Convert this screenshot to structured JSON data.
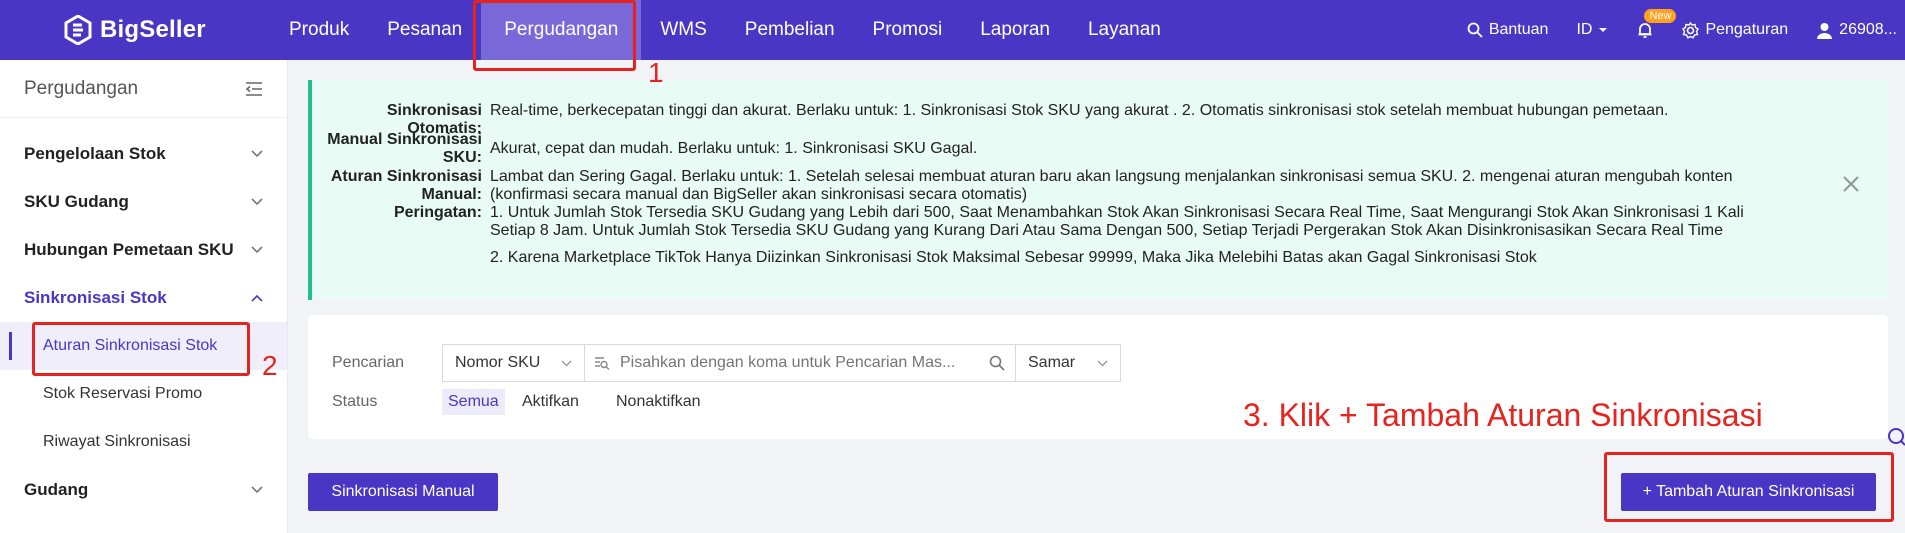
{
  "brand": {
    "name": "BigSeller"
  },
  "nav": {
    "items": [
      {
        "label": "Produk"
      },
      {
        "label": "Pesanan"
      },
      {
        "label": "Pergudangan",
        "active": true
      },
      {
        "label": "WMS"
      },
      {
        "label": "Pembelian"
      },
      {
        "label": "Promosi"
      },
      {
        "label": "Laporan"
      },
      {
        "label": "Layanan"
      }
    ],
    "help": "Bantuan",
    "language": "ID",
    "new_badge": "New",
    "settings": "Pengaturan",
    "user": "26908..."
  },
  "sidebar": {
    "title": "Pergudangan",
    "groups": [
      {
        "label": "Pengelolaan Stok"
      },
      {
        "label": "SKU Gudang"
      },
      {
        "label": "Hubungan Pemetaan SKU"
      },
      {
        "label": "Sinkronisasi Stok"
      }
    ],
    "sub_items": [
      {
        "label": "Aturan Sinkronisasi Stok"
      },
      {
        "label": "Stok Reservasi Promo"
      },
      {
        "label": "Riwayat Sinkronisasi"
      }
    ],
    "group_after": "Gudang"
  },
  "notice": {
    "auto_label": "Sinkronisasi Otomatis:",
    "auto_text": "Real-time, berkecepatan tinggi dan akurat. Berlaku untuk: 1. Sinkronisasi Stok SKU yang akurat . 2. Otomatis sinkronisasi stok setelah membuat hubungan pemetaan.",
    "manual_label_1": "Manual Sinkronisasi",
    "manual_label_2": "SKU:",
    "manual_text": "Akurat, cepat dan mudah. Berlaku untuk: 1. Sinkronisasi SKU Gagal.",
    "rule_label_1": "Aturan Sinkronisasi",
    "rule_label_2": "Manual:",
    "rule_text_1": "Lambat dan Sering Gagal. Berlaku untuk: 1. Setelah selesai membuat aturan baru akan langsung menjalankan sinkronisasi semua SKU. 2. mengenai aturan mengubah konten",
    "rule_text_2": "(konfirmasi secara manual dan BigSeller akan sinkronisasi secara otomatis)",
    "warn_label": "Peringatan:",
    "warn_text_1": "1. Untuk Jumlah Stok Tersedia SKU Gudang yang Lebih dari 500, Saat Menambahkan Stok Akan Sinkronisasi Secara Real Time, Saat Mengurangi Stok Akan Sinkronisasi 1 Kali",
    "warn_text_2": "Setiap 8 Jam. Untuk Jumlah Stok Tersedia SKU Gudang yang Kurang Dari Atau Sama Dengan 500, Setiap Terjadi Pergerakan Stok Akan Disinkronisasikan Secara Real Time",
    "warn_text_3": "2. Karena Marketplace TikTok Hanya Diizinkan Sinkronisasi Stok Maksimal Sebesar 99999, Maka Jika Melebihi Batas akan Gagal Sinkronisasi Stok"
  },
  "filter": {
    "search_label": "Pencarian",
    "search_type": "Nomor SKU",
    "search_placeholder": "Pisahkan dengan koma untuk Pencarian Mas...",
    "match_mode": "Samar",
    "status_label": "Status",
    "status_options": [
      {
        "label": "Semua",
        "active": true
      },
      {
        "label": "Aktifkan"
      },
      {
        "label": "Nonaktifkan"
      }
    ]
  },
  "actions": {
    "manual_sync": "Sinkronisasi Manual",
    "add_rule": "+ Tambah Aturan Sinkronisasi"
  },
  "annotations": {
    "n1": "1",
    "n2": "2",
    "n3": "3. Klik + Tambah Aturan Sinkronisasi"
  }
}
